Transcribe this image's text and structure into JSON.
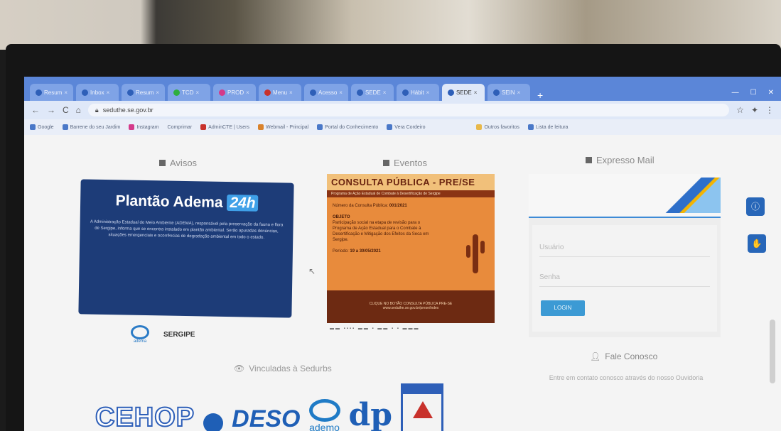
{
  "browser": {
    "tabs": [
      {
        "label": "Resum"
      },
      {
        "label": "Inbox"
      },
      {
        "label": "Resum"
      },
      {
        "label": "TCD"
      },
      {
        "label": "PROD"
      },
      {
        "label": "Menu"
      },
      {
        "label": "Acesso"
      },
      {
        "label": "SEDE"
      },
      {
        "label": "Hábit"
      },
      {
        "label": "SEDE",
        "active": true
      },
      {
        "label": "SEIN"
      }
    ],
    "url": "seduthe.se.gov.br",
    "bookmarks": [
      "Google",
      "Barrene do seu Jardim",
      "Instagram",
      "Comprimar",
      "AdminCTE | Users",
      "Webmail - Principal",
      "Portal do Conhecimento",
      "Vera Cordeiro",
      "Outros favoritos",
      "Lista de leitura"
    ]
  },
  "page": {
    "avisos": {
      "title": "Avisos",
      "card_title": "Plantão Adema",
      "card_badge": "24h",
      "card_text": "A Administração Estadual do Meio Ambiente (ADEMA), responsável pela preservação da fauna e flora de Sergipe, informa que se encontra instalado em plantão ambiental. Serão apuradas denúncias, situações emergenciais e ocorrências de degradação ambiental em todo o estado.",
      "logos": [
        "adema",
        "SERGIPE"
      ]
    },
    "eventos": {
      "title": "Eventos",
      "card_title": "CONSULTA PÚBLICA - PRE/SE",
      "card_sub": "Programa de Ação Estadual de Combate à Desertificação de Sergipe",
      "card_number_label": "Número da Consulta Pública:",
      "card_number": "001/2021",
      "card_objeto_label": "OBJETO",
      "card_objeto": "Participação social na etapa de revisão para o Programa de Ação Estadual para o Combate à Desertificação e Mitigação dos Efeitos da Seca em Sergipe.",
      "card_periodo_label": "Período:",
      "card_periodo": "19 a 30/05/2021",
      "card_footer": "CLIQUE NO BOTÃO CONSULTA PÚBLICA PRE-SE",
      "card_footer_link": "www.seduthe.se.gov.br/prese/index"
    },
    "mail": {
      "title": "Expresso Mail",
      "user_placeholder": "Usuário",
      "pass_placeholder": "Senha",
      "button": "LOGIN"
    },
    "vinculadas": {
      "title": "Vinculadas à Sedurbs",
      "logos": [
        "CEHOP",
        "DESO",
        "ademo",
        "dp"
      ]
    },
    "fale": {
      "title": "Fale Conosco",
      "text": "Entre em contato conosco através do nosso Ouvidoria"
    }
  }
}
